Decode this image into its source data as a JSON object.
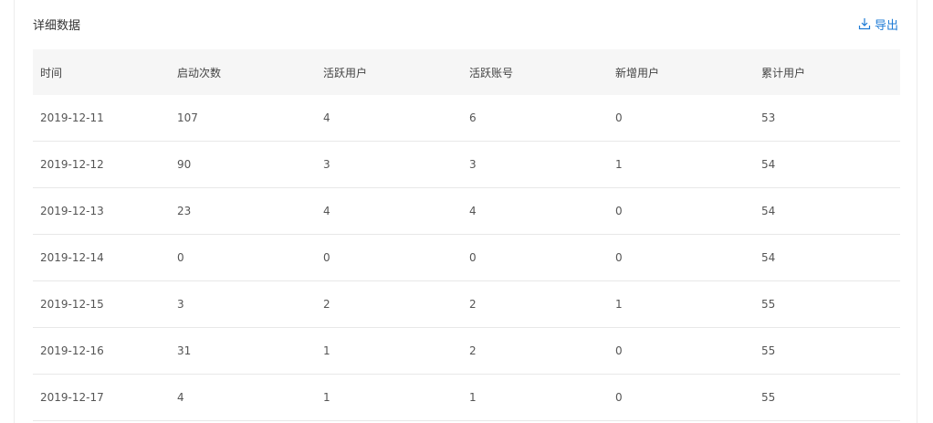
{
  "section": {
    "title": "详细数据",
    "export_label": "导出",
    "export_icon": "download-icon",
    "accent_color": "#1e7bd6"
  },
  "table": {
    "columns": [
      "时间",
      "启动次数",
      "活跃用户",
      "活跃账号",
      "新增用户",
      "累计用户"
    ],
    "rows": [
      [
        "2019-12-11",
        "107",
        "4",
        "6",
        "0",
        "53"
      ],
      [
        "2019-12-12",
        "90",
        "3",
        "3",
        "1",
        "54"
      ],
      [
        "2019-12-13",
        "23",
        "4",
        "4",
        "0",
        "54"
      ],
      [
        "2019-12-14",
        "0",
        "0",
        "0",
        "0",
        "54"
      ],
      [
        "2019-12-15",
        "3",
        "2",
        "2",
        "1",
        "55"
      ],
      [
        "2019-12-16",
        "31",
        "1",
        "2",
        "0",
        "55"
      ],
      [
        "2019-12-17",
        "4",
        "1",
        "1",
        "0",
        "55"
      ]
    ]
  }
}
